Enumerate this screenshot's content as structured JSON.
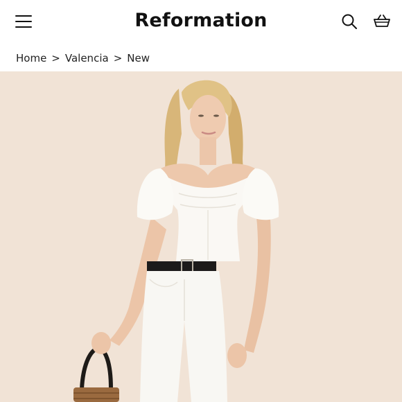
{
  "header": {
    "brand": "Reformation",
    "icons": {
      "menu": "hamburger-menu-icon",
      "search": "search-icon",
      "bag": "shopping-basket-icon"
    }
  },
  "breadcrumb": {
    "items": [
      "Home",
      "Valencia",
      "New"
    ],
    "separator": ">"
  },
  "hero": {
    "description": "Model wearing white puff-sleeve top, black belt, white high-waisted jeans, holding woven basket bag",
    "background_color": "#f1e3d6"
  },
  "colors": {
    "text": "#111111",
    "background": "#ffffff"
  }
}
